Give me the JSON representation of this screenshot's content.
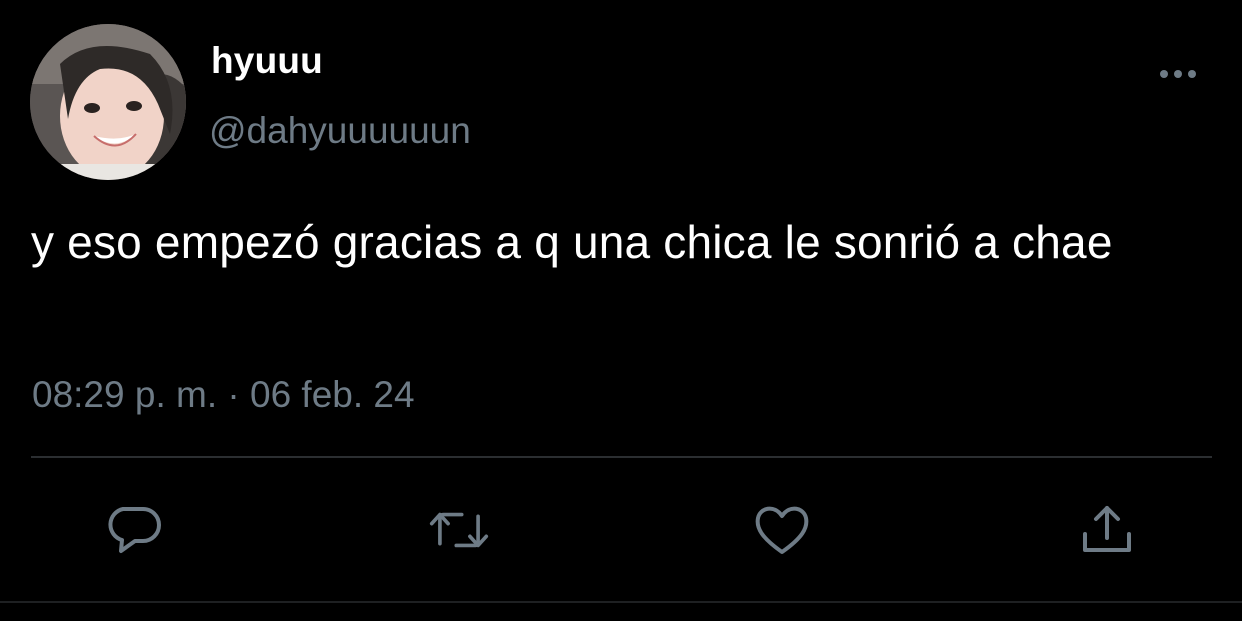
{
  "tweet": {
    "display_name": "hyuuu",
    "handle": "@dahyuuuuuun",
    "text": "y eso empezó gracias a q una chica le sonrió a chae",
    "time": "08:29 p. m.",
    "separator": "·",
    "date": "06 feb. 24"
  },
  "icons": {
    "more": "more-horizontal-icon",
    "reply": "reply-bubble-icon",
    "retweet": "retweet-icon",
    "like": "heart-icon",
    "share": "share-upload-icon"
  },
  "colors": {
    "background": "#000000",
    "primary_text": "#ffffff",
    "secondary_text": "#6e7b86",
    "icon": "#6e7b86",
    "divider": "#2b2e31"
  }
}
